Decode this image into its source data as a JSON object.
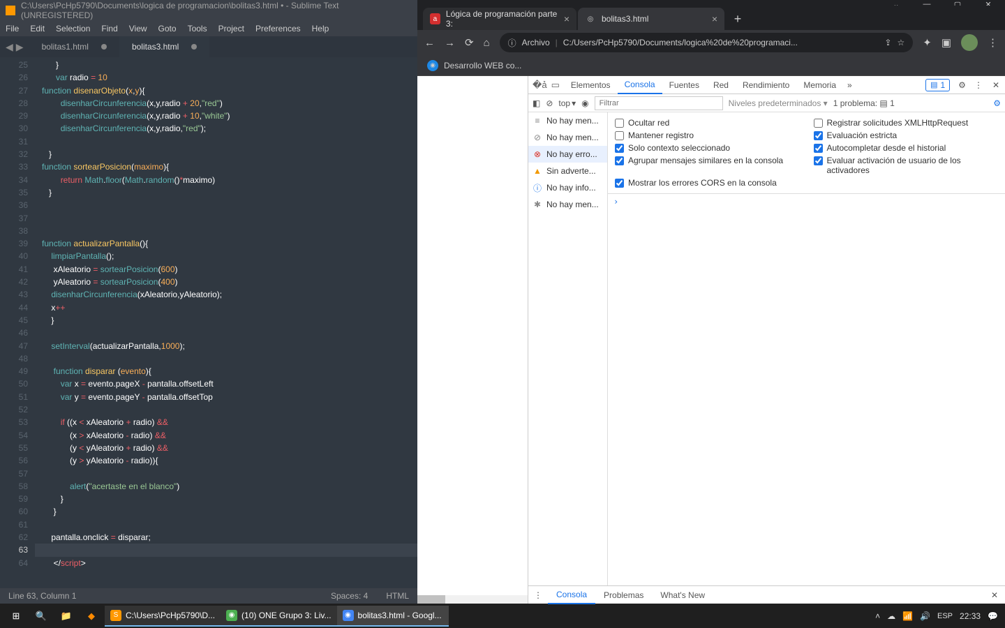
{
  "sublime": {
    "title": "C:\\Users\\PcHp5790\\Documents\\logica de programacion\\bolitas3.html • - Sublime Text (UNREGISTERED)",
    "menu": [
      "File",
      "Edit",
      "Selection",
      "Find",
      "View",
      "Goto",
      "Tools",
      "Project",
      "Preferences",
      "Help"
    ],
    "tabs": [
      {
        "label": "bolitas1.html"
      },
      {
        "label": "bolitas3.html"
      }
    ],
    "status": {
      "left": "Line 63, Column 1",
      "spaces": "Spaces: 4",
      "lang": "HTML"
    },
    "lines": [
      25,
      26,
      27,
      28,
      29,
      30,
      31,
      32,
      33,
      34,
      35,
      36,
      37,
      38,
      39,
      40,
      41,
      42,
      43,
      44,
      45,
      46,
      47,
      48,
      49,
      50,
      51,
      52,
      53,
      54,
      55,
      56,
      57,
      58,
      59,
      60,
      61,
      62,
      63,
      64
    ]
  },
  "chrome": {
    "tabs": [
      {
        "label": "Lógica de programación parte 3:",
        "favbg": "#d32f2f",
        "favtxt": "a"
      },
      {
        "label": "bolitas3.html",
        "favbg": "#555",
        "favtxt": "◎"
      }
    ],
    "url_prefix": "Archivo",
    "url": "C:/Users/PcHp5790/Documents/logica%20de%20programaci...",
    "bookmark": "Desarrollo WEB co...",
    "devtabs": [
      "Elementos",
      "Consola",
      "Fuentes",
      "Red",
      "Rendimiento",
      "Memoria"
    ],
    "devtabs_active": 1,
    "badge1": "1",
    "badge2": "1 problema:",
    "badge3": "1",
    "context": "top",
    "filter_ph": "Filtrar",
    "levels": "Niveles predeterminados",
    "side": [
      {
        "icon": "≡",
        "cls": "grey",
        "txt": "No hay men..."
      },
      {
        "icon": "⊘",
        "cls": "grey",
        "txt": "No hay men..."
      },
      {
        "icon": "⊗",
        "cls": "err",
        "txt": "No hay erro...",
        "sel": true
      },
      {
        "icon": "▲",
        "cls": "warn",
        "txt": "Sin adverte..."
      },
      {
        "icon": "ⓘ",
        "cls": "info",
        "txt": "No hay info..."
      },
      {
        "icon": "✱",
        "cls": "grey",
        "txt": "No hay men..."
      }
    ],
    "settings": [
      [
        {
          "chk": false,
          "txt": "Ocultar red"
        },
        {
          "chk": false,
          "txt": "Registrar solicitudes XMLHttpRequest"
        }
      ],
      [
        {
          "chk": false,
          "txt": "Mantener registro"
        },
        {
          "chk": true,
          "txt": "Evaluación estricta"
        }
      ],
      [
        {
          "chk": true,
          "txt": "Solo contexto seleccionado"
        },
        {
          "chk": true,
          "txt": "Autocompletar desde el historial"
        }
      ],
      [
        {
          "chk": true,
          "txt": "Agrupar mensajes similares en la consola"
        },
        {
          "chk": true,
          "txt": "Evaluar activación de usuario de los activadores"
        }
      ],
      [
        {
          "chk": true,
          "txt": "Mostrar los errores CORS en la consola"
        },
        null
      ]
    ],
    "footer": [
      "Consola",
      "Problemas",
      "What's New"
    ]
  },
  "taskbar": {
    "apps": [
      {
        "icon": "S",
        "bg": "#ff9800",
        "label": "C:\\Users\\PcHp5790\\D..."
      },
      {
        "icon": "◉",
        "bg": "#4caf50",
        "label": "(10) ONE Grupo 3: Liv..."
      },
      {
        "icon": "◉",
        "bg": "#4285f4",
        "label": "bolitas3.html - Googl...",
        "sel": true
      }
    ],
    "lang": "ESP",
    "time": "22:33"
  }
}
